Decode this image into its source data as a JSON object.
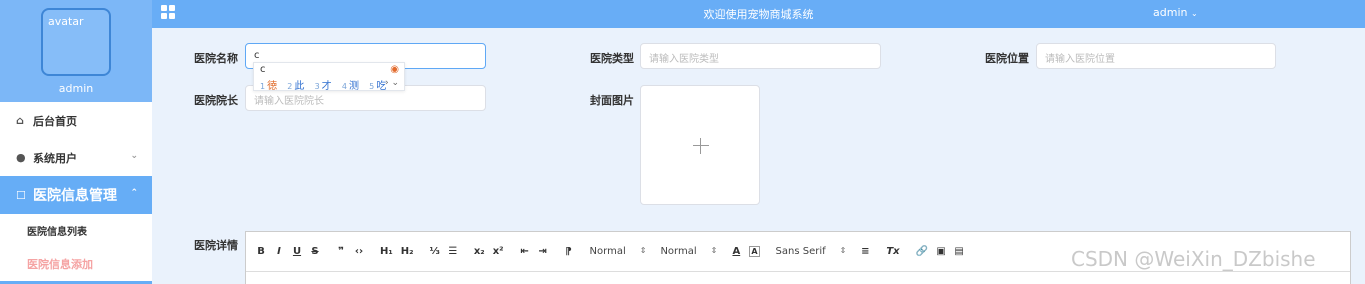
{
  "sidebar": {
    "avatar_alt": "avatar",
    "username": "admin",
    "menu": [
      {
        "label": "后台首页",
        "icon": "home-icon"
      },
      {
        "label": "系统用户",
        "icon": "user-icon"
      },
      {
        "label": "医院信息管理",
        "icon": "edit-icon"
      }
    ],
    "submenu": [
      "医院信息列表",
      "医院信息添加"
    ]
  },
  "topbar": {
    "title": "欢迎使用宠物商城系统",
    "user": "admin"
  },
  "form": {
    "name_label": "医院名称",
    "name_value": "c",
    "type_label": "医院类型",
    "type_placeholder": "请输入医院类型",
    "location_label": "医院位置",
    "location_placeholder": "请输入医院位置",
    "director_label": "医院院长",
    "director_placeholder": "请输入医院院长",
    "cover_label": "封面图片",
    "detail_label": "医院详情"
  },
  "ime": {
    "typed": "c",
    "candidates": [
      {
        "n": "1",
        "c": "徳"
      },
      {
        "n": "2",
        "c": "此"
      },
      {
        "n": "3",
        "c": "才"
      },
      {
        "n": "4",
        "c": "测"
      },
      {
        "n": "5",
        "c": "吃"
      }
    ],
    "nav": "› ⌄"
  },
  "editor": {
    "toolbar": {
      "bold": "B",
      "italic": "I",
      "underline": "U",
      "strike": "S",
      "quote": "❞",
      "code": "‹›",
      "h1": "H₁",
      "h2": "H₂",
      "ordered_list": "⅓",
      "bullet_list": "☰",
      "subscript": "x₂",
      "superscript": "x²",
      "outdent": "⇤",
      "indent": "⇥",
      "direction": "⁋",
      "size_select": "Normal",
      "header_select": "Normal",
      "color": "A",
      "background": "A",
      "font_select": "Sans Serif",
      "align": "≡",
      "clean": "Tx",
      "link": "🔗",
      "image": "▣",
      "video": "▤"
    }
  },
  "watermark": "CSDN @WeiXin_DZbishe"
}
